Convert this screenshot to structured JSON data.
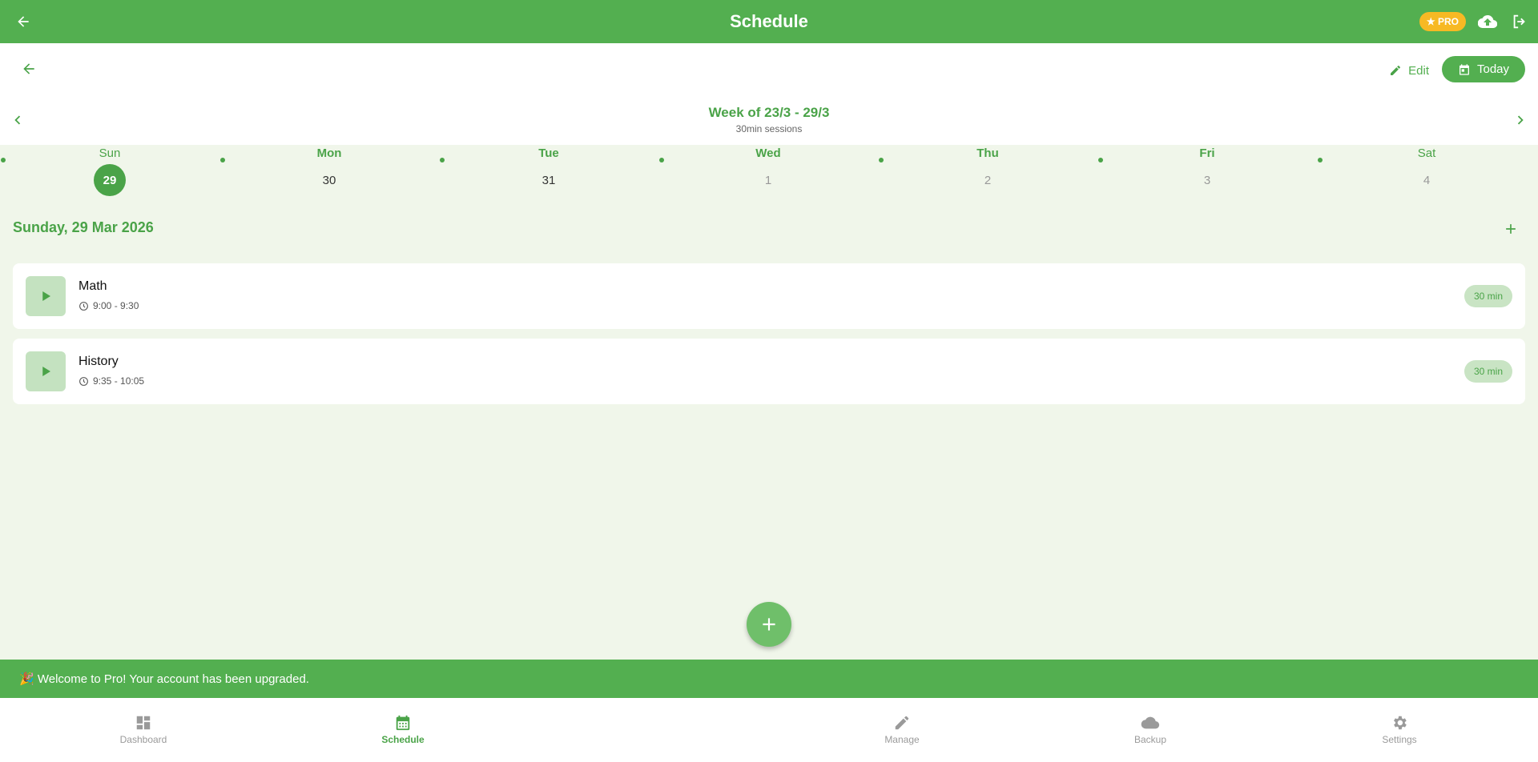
{
  "appbar": {
    "title": "Schedule",
    "pro_badge": "★ PRO"
  },
  "toolbar": {
    "edit_label": "Edit",
    "today_label": "Today"
  },
  "week": {
    "title": "Week of 23/3 - 29/3",
    "subtitle": "30min sessions"
  },
  "days": [
    {
      "name": "Sun",
      "num": "29"
    },
    {
      "name": "Mon",
      "num": "30"
    },
    {
      "name": "Tue",
      "num": "31"
    },
    {
      "name": "Wed",
      "num": "1"
    },
    {
      "name": "Thu",
      "num": "2"
    },
    {
      "name": "Fri",
      "num": "3"
    },
    {
      "name": "Sat",
      "num": "4"
    }
  ],
  "selected_date": "Sunday, 29 Mar 2026",
  "sessions": [
    {
      "name": "Math",
      "time": "9:00 - 9:30",
      "duration": "30 min"
    },
    {
      "name": "History",
      "time": "9:35 - 10:05",
      "duration": "30 min"
    }
  ],
  "snackbar": {
    "text": "🎉 Welcome to Pro! Your account has been upgraded."
  },
  "nav": [
    {
      "label": "Dashboard",
      "icon": "dashboard-icon"
    },
    {
      "label": "Schedule",
      "icon": "calendar-icon"
    },
    {
      "label": "Manage",
      "icon": "pencil-icon"
    },
    {
      "label": "Backup",
      "icon": "cloud-icon"
    },
    {
      "label": "Settings",
      "icon": "gear-icon"
    }
  ],
  "colors": {
    "primary": "#53af50",
    "accent_text": "#4aa348",
    "background": "#f0f6ea",
    "pro": "#f7b924"
  }
}
